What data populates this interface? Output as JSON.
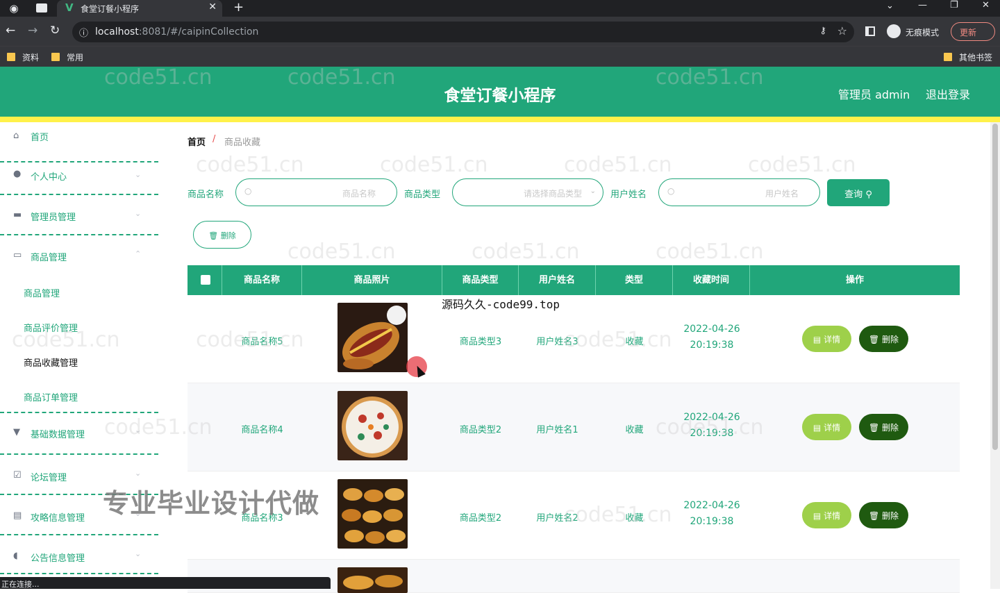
{
  "browser": {
    "tab_title": "食堂订餐小程序",
    "url_host": "localhost",
    "url_rest": ":8081/#/caipinCollection",
    "incognito_label": "无痕模式",
    "update_label": "更新",
    "bookmarks": [
      "资料",
      "常用"
    ],
    "other_bookmarks": "其他书签",
    "status_text": "正在连接..."
  },
  "header": {
    "title": "食堂订餐小程序",
    "admin_label": "管理员 admin",
    "logout_label": "退出登录",
    "colors": {
      "primary": "#21a67a",
      "accent_bar": "#fff14a"
    }
  },
  "sidebar": {
    "items": [
      {
        "label": "首页",
        "icon": "home-icon"
      },
      {
        "label": "个人中心",
        "icon": "user-icon"
      },
      {
        "label": "管理员管理",
        "icon": "admin-icon"
      },
      {
        "label": "商品管理",
        "icon": "chat-icon"
      },
      {
        "label": "基础数据管理",
        "icon": "data-icon"
      },
      {
        "label": "论坛管理",
        "icon": "forum-icon"
      },
      {
        "label": "攻略信息管理",
        "icon": "guide-icon"
      },
      {
        "label": "公告信息管理",
        "icon": "notice-icon"
      }
    ],
    "sub_items": [
      "商品管理",
      "商品评价管理",
      "商品收藏管理",
      "商品订单管理"
    ]
  },
  "breadcrumb": {
    "home": "首页",
    "sep": "/",
    "current": "商品收藏"
  },
  "filters": {
    "name_label": "商品名称",
    "name_placeholder": "商品名称",
    "type_label": "商品类型",
    "type_placeholder": "请选择商品类型",
    "user_label": "用户姓名",
    "user_placeholder": "用户姓名",
    "search_label": "查询"
  },
  "bulk_delete_label": "删除",
  "table": {
    "headers": [
      "商品名称",
      "商品照片",
      "商品类型",
      "用户姓名",
      "类型",
      "收藏时间",
      "操作"
    ],
    "rows": [
      {
        "name": "商品名称5",
        "type": "商品类型3",
        "user": "用户姓名3",
        "kind": "收藏",
        "date": "2022-04-26",
        "time": "20:19:38",
        "photo": "hotdog"
      },
      {
        "name": "商品名称4",
        "type": "商品类型2",
        "user": "用户姓名1",
        "kind": "收藏",
        "date": "2022-04-26",
        "time": "20:19:38",
        "photo": "pizza"
      },
      {
        "name": "商品名称3",
        "type": "商品类型2",
        "user": "用户姓名2",
        "kind": "收藏",
        "date": "2022-04-26",
        "time": "20:19:38",
        "photo": "pastries"
      }
    ],
    "detail_label": "详情",
    "delete_label": "删除"
  },
  "overlays": {
    "source_text": "源码久久-code99.top",
    "promo_text": "专业毕业设计代做",
    "watermark": "code51.cn"
  }
}
